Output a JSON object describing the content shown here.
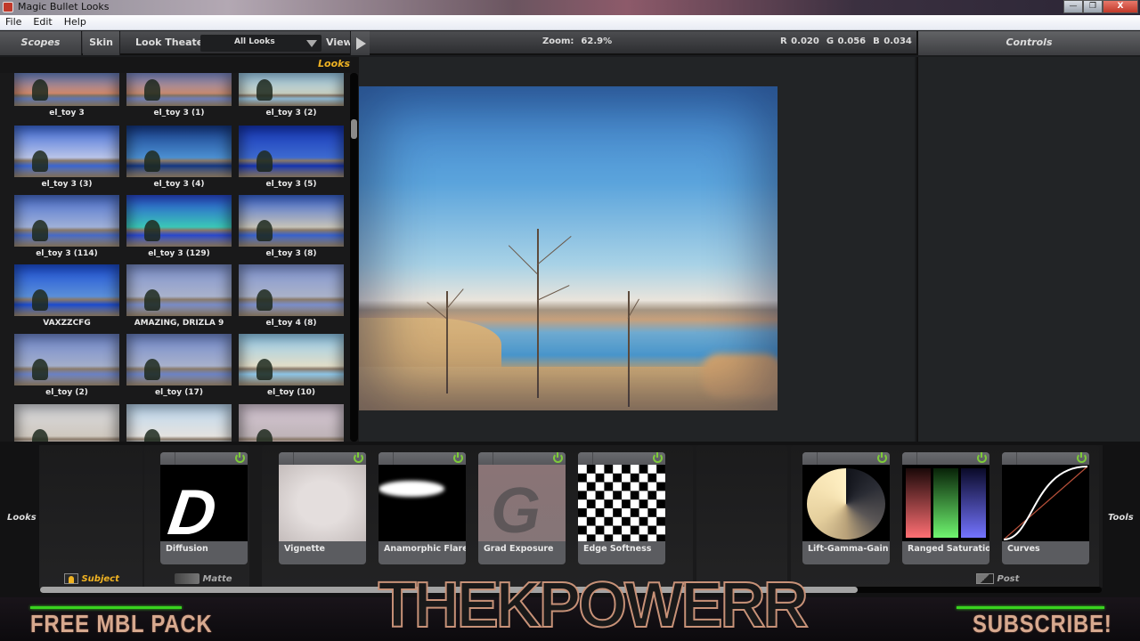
{
  "window": {
    "title": "Magic Bullet Looks",
    "buttons": [
      "minimize",
      "restore",
      "close"
    ],
    "close_label": "X"
  },
  "menu": [
    "File",
    "Edit",
    "Help"
  ],
  "toolbar": {
    "scopes": "Scopes",
    "skin": "Skin",
    "look_theater": "Look Theater",
    "filter_value": "All Looks",
    "view": "View",
    "zoom_label": "Zoom:",
    "zoom_value": "62.9%",
    "r": "R 0.020",
    "g": "G 0.056",
    "b": "B 0.034",
    "controls": "Controls"
  },
  "looks_panel": {
    "header": "Looks",
    "items": [
      {
        "label": "el_toy 3",
        "tint": [
          "#6c86c8",
          "#d38a6c"
        ]
      },
      {
        "label": "el_toy 3 (1)",
        "tint": [
          "#7f8fcf",
          "#c98c72"
        ]
      },
      {
        "label": "el_toy 3 (2)",
        "tint": [
          "#9fd0ef",
          "#c9d0c2"
        ]
      },
      {
        "label": "el_toy 3 (3)",
        "tint": [
          "#3d6ad9",
          "#b9c4e8"
        ]
      },
      {
        "label": "el_toy 3 (4)",
        "tint": [
          "#153a88",
          "#4b8fd1"
        ]
      },
      {
        "label": "el_toy 3 (5)",
        "tint": [
          "#1536b8",
          "#3d6ad0"
        ]
      },
      {
        "label": "el_toy 3 (114)",
        "tint": [
          "#4a6fcf",
          "#9fb0d8"
        ]
      },
      {
        "label": "el_toy 3 (129)",
        "tint": [
          "#2a4bd6",
          "#3ac7b7"
        ]
      },
      {
        "label": "el_toy 3 (8)",
        "tint": [
          "#3a66d6",
          "#c6c3b8"
        ]
      },
      {
        "label": "VAXZZCFG",
        "tint": [
          "#1c4fd8",
          "#5a8fd8"
        ]
      },
      {
        "label": "AMAZING, DRIZLA 9",
        "tint": [
          "#7e92cf",
          "#a9b2cc"
        ]
      },
      {
        "label": "el_toy 4 (8)",
        "tint": [
          "#7f94d3",
          "#aab2c9"
        ]
      },
      {
        "label": "el_toy (2)",
        "tint": [
          "#6f87cd",
          "#a3aecb"
        ]
      },
      {
        "label": "el_toy (17)",
        "tint": [
          "#7189cd",
          "#a8b1cc"
        ]
      },
      {
        "label": "el_toy (10)",
        "tint": [
          "#93cdf0",
          "#e1ddc8"
        ]
      },
      {
        "label": "",
        "tint": [
          "#d9dbe0",
          "#cfc8bf"
        ]
      },
      {
        "label": "",
        "tint": [
          "#bcd9f2",
          "#e4e2df"
        ]
      },
      {
        "label": "",
        "tint": [
          "#d7c8d6",
          "#bfb4b8"
        ]
      }
    ]
  },
  "bottom": {
    "left_label": "Looks",
    "right_label": "Tools",
    "subject": "Subject",
    "matte": "Matte",
    "post": "Post",
    "subject_color": "#f0b323",
    "scroll_fraction": 0.77,
    "tools": [
      {
        "name": "Diffusion",
        "glyph": "D",
        "enabled": true
      },
      {
        "name": "Vignette",
        "enabled": true
      },
      {
        "name": "Anamorphic Flare",
        "enabled": true
      },
      {
        "name": "Grad Exposure",
        "glyph": "G",
        "enabled": true
      },
      {
        "name": "Edge Softness",
        "enabled": true
      },
      {
        "name": "Lift-Gamma-Gain",
        "enabled": true
      },
      {
        "name": "Ranged Saturation",
        "enabled": true
      },
      {
        "name": "Curves",
        "enabled": true
      }
    ]
  },
  "banner": {
    "left": "FREE MBL PACK",
    "center": "THEKPOWERR",
    "right": "SUBSCRIBE!",
    "accent": "#39d21f"
  }
}
